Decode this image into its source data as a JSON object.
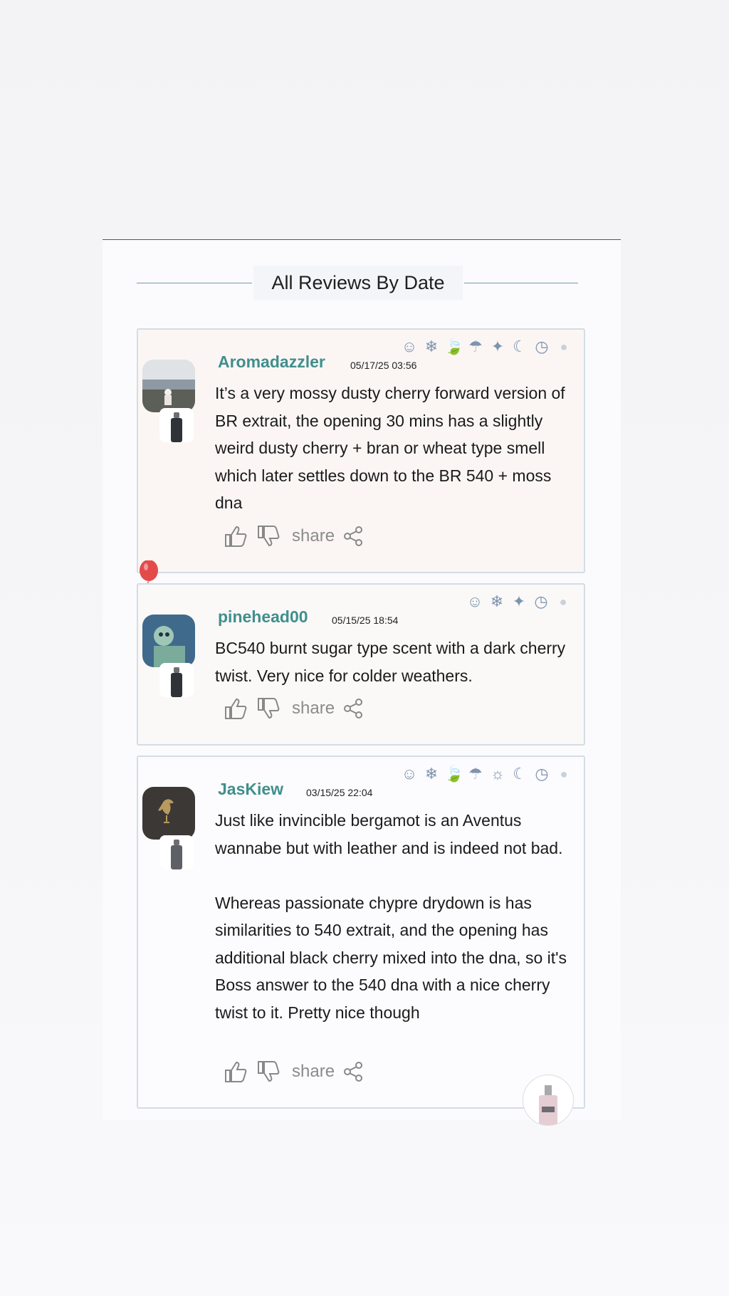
{
  "section_title": "All Reviews By Date",
  "reviews": [
    {
      "username": "Aromadazzler",
      "date": "05/17/25 03:56",
      "text": "It’s a very mossy dusty cherry forward version of BR extrait, the opening 30 mins has a slightly weird dusty cherry + bran or wheat type smell which later settles down to the BR 540 + moss dna",
      "icons": [
        "smile-icon",
        "snowflake-icon",
        "leaf-icon",
        "umbrella-icon",
        "maple-leaf-icon",
        "moon-icon",
        "clock-icon",
        "person-icon"
      ],
      "share_label": "share"
    },
    {
      "username": "pinehead00",
      "date": "05/15/25 18:54",
      "text": "BC540 burnt sugar type scent with a dark cherry twist. Very nice for colder weathers.",
      "icons": [
        "heart-eyes-icon",
        "snowflake-icon",
        "maple-leaf-icon",
        "clock-icon",
        "person-icon"
      ],
      "share_label": "share"
    },
    {
      "username": "JasKiew",
      "date": "03/15/25 22:04",
      "text": "Just like invincible bergamot is an Aventus wannabe but with leather and is indeed not bad.\n\nWhereas passionate chypre drydown is has similarities to 540 extrait, and the opening has additional black cherry mixed into the dna, so it's Boss answer to the 540 dna with a nice cherry twist to it. Pretty nice though",
      "icons": [
        "heart-eyes-icon",
        "snowflake-icon",
        "leaf-icon",
        "umbrella-icon",
        "sun-icon",
        "moon-icon",
        "clock-icon",
        "person-icon"
      ],
      "share_label": "share"
    }
  ]
}
